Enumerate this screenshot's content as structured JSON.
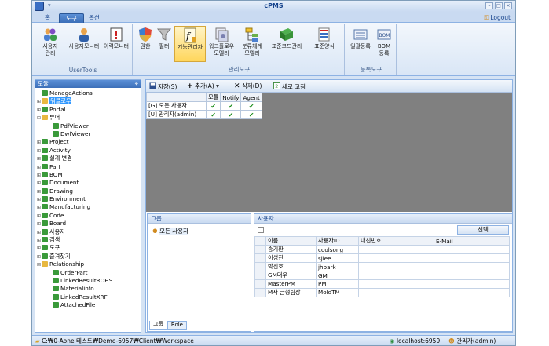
{
  "app": {
    "title": "cPMS",
    "logout": "Logout"
  },
  "tabs": [
    {
      "label": "홈"
    },
    {
      "label": "도구"
    },
    {
      "label": "옵션"
    }
  ],
  "ribbon": {
    "groups": [
      {
        "label": "UserTools",
        "buttons": [
          "사용자\n관리",
          "사용자모니터",
          "이력모니터"
        ]
      },
      {
        "label": "관리도구",
        "buttons": [
          "권한",
          "필터",
          "기능관리자",
          "워크플로우\n모델러",
          "분류체계\n모델러",
          "표준코드관리",
          "표준양식"
        ]
      },
      {
        "label": "등록도구",
        "buttons": [
          "일괄등록",
          "BOM\n등록"
        ]
      }
    ]
  },
  "sidebar": {
    "title": "모듈",
    "items": [
      {
        "label": "ManageActions",
        "depth": 0,
        "exp": ""
      },
      {
        "label": "워클로우",
        "depth": 0,
        "exp": "+",
        "sel": true
      },
      {
        "label": "Portal",
        "depth": 0,
        "exp": "+"
      },
      {
        "label": "뷰어",
        "depth": 0,
        "exp": "-"
      },
      {
        "label": "PdfViewer",
        "depth": 1,
        "exp": ""
      },
      {
        "label": "DwfViewer",
        "depth": 1,
        "exp": ""
      },
      {
        "label": "Project",
        "depth": 0,
        "exp": "+"
      },
      {
        "label": "Activity",
        "depth": 0,
        "exp": "+"
      },
      {
        "label": "설계 변경",
        "depth": 0,
        "exp": "+"
      },
      {
        "label": "Part",
        "depth": 0,
        "exp": "+"
      },
      {
        "label": "BOM",
        "depth": 0,
        "exp": "+"
      },
      {
        "label": "Document",
        "depth": 0,
        "exp": "+"
      },
      {
        "label": "Drawing",
        "depth": 0,
        "exp": "+"
      },
      {
        "label": "Environment",
        "depth": 0,
        "exp": "+"
      },
      {
        "label": "Manufacturing",
        "depth": 0,
        "exp": "+"
      },
      {
        "label": "Code",
        "depth": 0,
        "exp": "+"
      },
      {
        "label": "Board",
        "depth": 0,
        "exp": "+"
      },
      {
        "label": "사용자",
        "depth": 0,
        "exp": "+"
      },
      {
        "label": "검색",
        "depth": 0,
        "exp": "+"
      },
      {
        "label": "도구",
        "depth": 0,
        "exp": "+"
      },
      {
        "label": "즐겨찾기",
        "depth": 0,
        "exp": "+"
      },
      {
        "label": "Relationship",
        "depth": 0,
        "exp": "-"
      },
      {
        "label": "OrderPart",
        "depth": 1,
        "exp": ""
      },
      {
        "label": "LinkedResultROHS",
        "depth": 1,
        "exp": ""
      },
      {
        "label": "Materialinfo",
        "depth": 1,
        "exp": ""
      },
      {
        "label": "LinkedResultXRF",
        "depth": 1,
        "exp": ""
      },
      {
        "label": "AttachedFile",
        "depth": 1,
        "exp": ""
      }
    ]
  },
  "toolbar": {
    "save": "저장(S)",
    "add": "추가(A)",
    "del": "삭제(D)",
    "refresh": "새로 고침"
  },
  "perm_grid": {
    "headers": [
      "모듈",
      "Notify",
      "Agent"
    ],
    "rows": [
      {
        "label": "[G] 모든 사용자"
      },
      {
        "label": "[U] 관리자(admin)"
      }
    ]
  },
  "group_panel": {
    "title": "그룹",
    "item": "모든 사용자",
    "tabs": [
      "그룹",
      "Role"
    ]
  },
  "user_panel": {
    "title": "사용자",
    "select": "선택",
    "headers": [
      "이름",
      "사용자ID",
      "내선번호",
      "E-Mail"
    ],
    "rows": [
      [
        "송기환",
        "coolsong",
        "",
        ""
      ],
      [
        "이성진",
        "sjlee",
        "",
        ""
      ],
      [
        "박진호",
        "jhpark",
        "",
        ""
      ],
      [
        "GM대우",
        "GM",
        "",
        ""
      ],
      [
        "MasterPM",
        "PM",
        "",
        ""
      ],
      [
        "M사 금형팀장",
        "MoldTM",
        "",
        ""
      ]
    ]
  },
  "status": {
    "path": "C:₩0-Aone 테스트₩Demo-6957₩Client₩Workspace",
    "server": "localhost:6959",
    "user": "관리자(admin)"
  }
}
